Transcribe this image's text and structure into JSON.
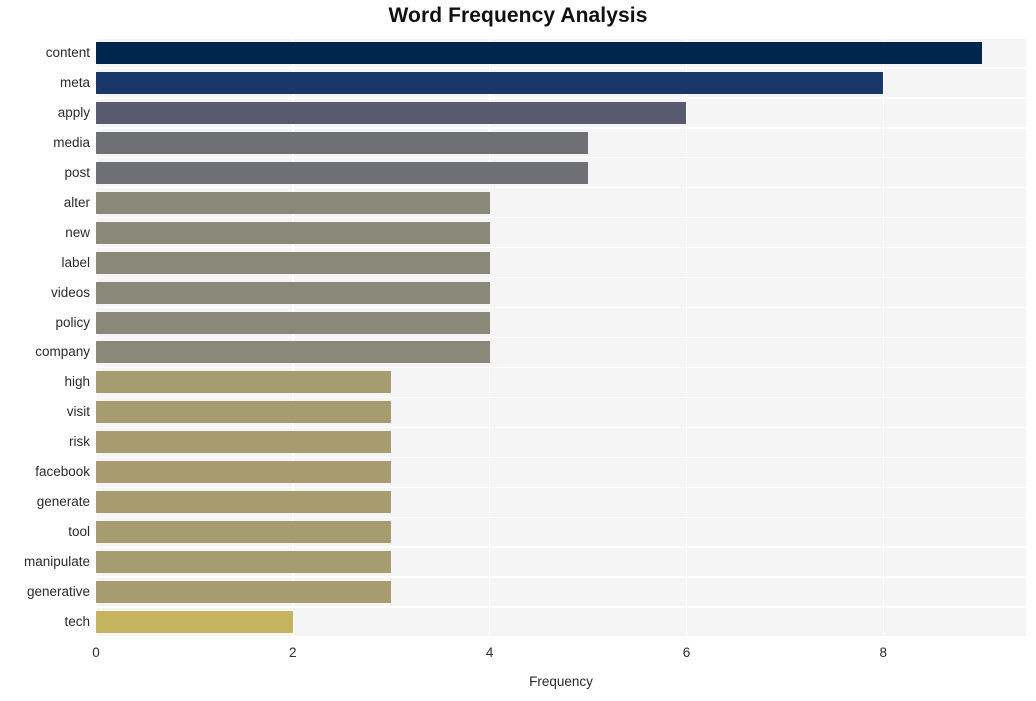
{
  "chart_data": {
    "type": "bar",
    "orientation": "horizontal",
    "title": "Word Frequency Analysis",
    "xlabel": "Frequency",
    "ylabel": "",
    "categories": [
      "content",
      "meta",
      "apply",
      "media",
      "post",
      "alter",
      "new",
      "label",
      "videos",
      "policy",
      "company",
      "high",
      "visit",
      "risk",
      "facebook",
      "generate",
      "tool",
      "manipulate",
      "generative",
      "tech"
    ],
    "values": [
      9,
      8,
      6,
      5,
      5,
      4,
      4,
      4,
      4,
      4,
      4,
      3,
      3,
      3,
      3,
      3,
      3,
      3,
      3,
      2
    ],
    "bar_colors": [
      "#00264d",
      "#1b3668",
      "#585b70",
      "#6e7075",
      "#6e7075",
      "#8a8878",
      "#8a8878",
      "#8a8878",
      "#8a8878",
      "#8a8878",
      "#8a8878",
      "#a69c70",
      "#a69c70",
      "#a69c70",
      "#a69c70",
      "#a69c70",
      "#a69c70",
      "#a69c70",
      "#a69c70",
      "#c6b460"
    ],
    "xlim": [
      0,
      9.45
    ],
    "xticks": [
      0,
      2,
      4,
      6,
      8
    ],
    "xtick_labels": [
      "0",
      "2",
      "4",
      "6",
      "8"
    ],
    "grid": true,
    "legend": false,
    "plot_background": "#f5f5f6",
    "grid_color": "#ffffff",
    "figure_background": "#ffffff",
    "colormap": "cividis_reversed"
  }
}
